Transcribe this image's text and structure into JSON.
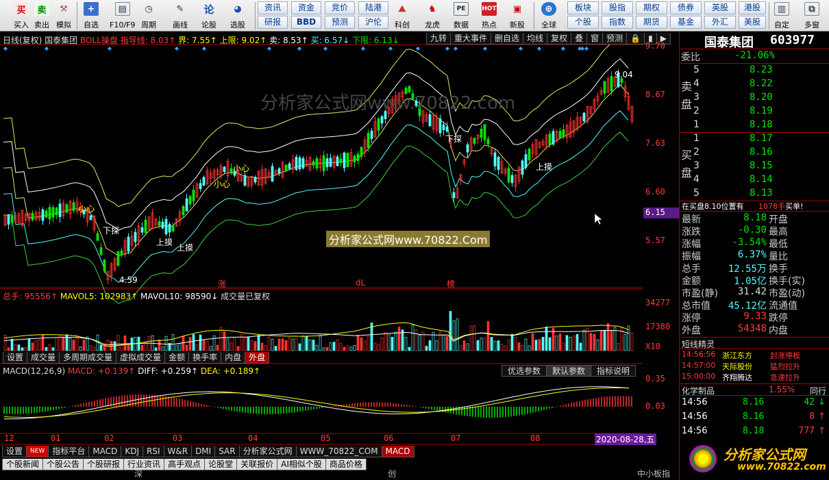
{
  "toolbar": {
    "buttons": [
      "买入",
      "卖出",
      "模拟",
      "自选",
      "F10/F9",
      "周期",
      "画线",
      "论股",
      "选股",
      "科创",
      "龙虎",
      "数据",
      "热点",
      "新股",
      "全球",
      "自定",
      "多窗"
    ],
    "grid": [
      [
        "资讯",
        "资金",
        "竞价",
        "陆港"
      ],
      [
        "研报",
        "BBD",
        "预测",
        "沪伦"
      ],
      [
        "板块",
        "股指",
        "期权",
        "债券",
        "英股",
        "港股"
      ],
      [
        "个股",
        "指数",
        "期货",
        "基金",
        "外汇",
        "美股"
      ]
    ]
  },
  "chart": {
    "title": "日线(复权) 国泰集团",
    "boll": {
      "name": "BOLL操盘",
      "hint": "指导线: 8.03↑",
      "jie": "界: 7.55↑",
      "upper": "上限: 9.02↑",
      "sell": "卖: 8.53↑",
      "buy": "买: 6.57↓",
      "lower": "下限: 6.13↓"
    },
    "top_buttons": [
      "九转",
      "重大事件",
      "删自选",
      "均线",
      "复权",
      "叠",
      "窗",
      "预测"
    ],
    "price_axis": [
      "9.70",
      "8.67",
      "7.63",
      "6.60",
      "5.57"
    ],
    "cursor_price": "6.15",
    "annotations": {
      "high": "9.04",
      "low": "4.59",
      "up1": "上摸",
      "up2": "上摸",
      "up3": "上摸",
      "down1": "下探",
      "down2": "下探",
      "heart1": "小心",
      "heart2": "小心",
      "heart3": "小心",
      "zhang": "涨",
      "dl": "dL",
      "bang": "榜"
    },
    "watermark1": "分析家公式网www.70822.com",
    "watermark2": "分析家公式网www.70822.Com",
    "vol": {
      "total": "总手: 95556↑",
      "ma5": "MAVOL5: 102983↑",
      "ma10": "MAVOL10: 98590↓",
      "note": "成交量已复权",
      "axis": [
        "34277",
        "17380",
        "X10"
      ]
    },
    "vol_tabs": [
      "设置",
      "成交量",
      "多周期成交量",
      "虚拟成交量",
      "金额",
      "换手率",
      "内盘",
      "外盘"
    ],
    "macd": {
      "title": "MACD(12,26,9)",
      "macd": "MACD: +0.139↑",
      "diff": "DIFF: +0.259↑",
      "dea": "DEA: +0.189↑",
      "axis": [
        "0.35",
        "0.03"
      ],
      "buttons": [
        "优选参数",
        "默认参数",
        "指标说明"
      ]
    },
    "xaxis": [
      "12",
      "01",
      "02",
      "03",
      "04",
      "05",
      "06",
      "07",
      "08"
    ],
    "date": "2020-08-28,五",
    "bottom_tabs": [
      "设置",
      "NEW",
      "指标平台",
      "MACD",
      "KDJ",
      "RSI",
      "W&R",
      "DMI",
      "SAR",
      "分析家公式网",
      "WWW_70822_COM",
      "MACD"
    ],
    "bottom_row2": [
      "个股新闻",
      "个股公告",
      "个股研报",
      "行业资讯",
      "高手观点",
      "论股堂",
      "关联报价",
      "AI相似个股",
      "商品价格",
      "深",
      "创",
      "中小板指"
    ]
  },
  "quote": {
    "name": "国泰集团",
    "code": "603977",
    "weibi_label": "委比",
    "weibi": "-21.06%",
    "sell_label": "卖盘",
    "buy_label": "买盘",
    "asks": [
      {
        "n": "5",
        "p": "8.23"
      },
      {
        "n": "4",
        "p": "8.22"
      },
      {
        "n": "3",
        "p": "8.20"
      },
      {
        "n": "2",
        "p": "8.19"
      },
      {
        "n": "1",
        "p": "8.18"
      }
    ],
    "bids": [
      {
        "n": "1",
        "p": "8.17"
      },
      {
        "n": "2",
        "p": "8.16"
      },
      {
        "n": "3",
        "p": "8.15"
      },
      {
        "n": "4",
        "p": "8.14"
      },
      {
        "n": "5",
        "p": "8.13"
      }
    ],
    "notice": "在买盘8.10位置有",
    "notice_vol": "1078手",
    "notice_tail": "买单!",
    "stats": [
      [
        "最新",
        "8.18",
        "开盘",
        ""
      ],
      [
        "涨跌",
        "-0.30",
        "最高",
        ""
      ],
      [
        "涨幅",
        "-3.54%",
        "最低",
        ""
      ],
      [
        "振幅",
        "6.37%",
        "量比",
        ""
      ],
      [
        "总手",
        "12.55万",
        "换手",
        ""
      ],
      [
        "金额",
        "1.05亿",
        "换手(实)",
        ""
      ],
      [
        "市盈(静)",
        "31.42",
        "市盈(动)",
        ""
      ],
      [
        "总市值",
        "45.12亿",
        "流通值",
        ""
      ],
      [
        "涨停",
        "9.33",
        "跌停",
        ""
      ],
      [
        "外盘",
        "54348",
        "内盘",
        ""
      ]
    ],
    "jingling_title": "短线精灵",
    "jingling": [
      [
        "14:56:56",
        "浙江东方",
        "封涨停板"
      ],
      [
        "14:57:00",
        "天际股份",
        "猛烈拉升"
      ],
      [
        "15:00:00",
        "齐翔腾达",
        "急速拉升"
      ]
    ],
    "sector": "化学制品",
    "sector_pct": "1.55%",
    "sector_tail": "同行",
    "ticks": [
      [
        "14:56",
        "8.16",
        "42",
        "↓"
      ],
      [
        "14:56",
        "8.16",
        "8",
        "↑"
      ],
      [
        "14:56",
        "8.18",
        "777",
        "↑"
      ]
    ],
    "logo_text": "分析家公式网",
    "logo_url": "www.70822.com"
  },
  "colors": {
    "up": "#ff3232",
    "down": "#54fcfc",
    "green": "#00e600",
    "yellow": "#ffff00",
    "ma": "#ffffff",
    "panel_red": "#a00000"
  }
}
